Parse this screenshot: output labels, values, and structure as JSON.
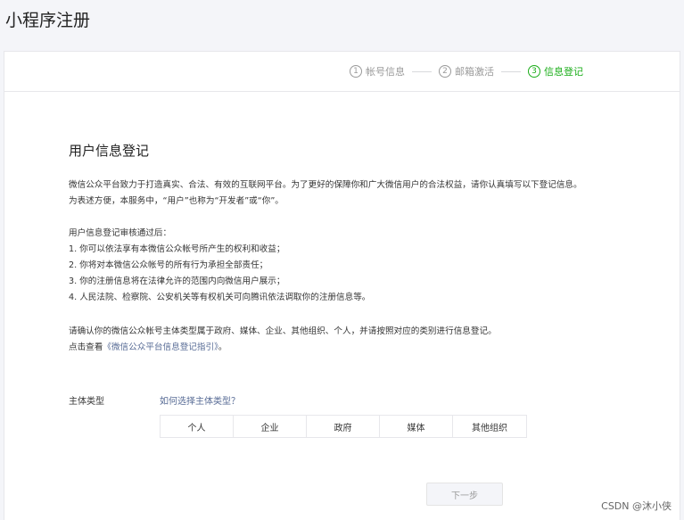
{
  "page_title": "小程序注册",
  "steps": [
    {
      "num": "1",
      "label": "帐号信息"
    },
    {
      "num": "2",
      "label": "邮箱激活"
    },
    {
      "num": "3",
      "label": "信息登记"
    }
  ],
  "active_step_color": "#1aad19",
  "section_title": "用户信息登记",
  "intro": {
    "line1": "微信公众平台致力于打造真实、合法、有效的互联网平台。为了更好的保障你和广大微信用户的合法权益，请你认真填写以下登记信息。",
    "line2": "为表述方便，本服务中，“用户”也称为“开发者”或“你”。"
  },
  "approval": {
    "heading": "用户信息登记审核通过后：",
    "items": [
      "1. 你可以依法享有本微信公众帐号所产生的权利和收益；",
      "2. 你将对本微信公众帐号的所有行为承担全部责任；",
      "3. 你的注册信息将在法律允许的范围内向微信用户展示；",
      "4. 人民法院、检察院、公安机关等有权机关可向腾讯依法调取你的注册信息等。"
    ]
  },
  "confirm": {
    "line1": "请确认你的微信公众帐号主体类型属于政府、媒体、企业、其他组织、个人，并请按照对应的类别进行信息登记。",
    "line2_prefix": "点击查看",
    "line2_link": "《微信公众平台信息登记指引》",
    "line2_suffix": "。"
  },
  "subject_type": {
    "label": "主体类型",
    "help_link": "如何选择主体类型？",
    "options": [
      "个人",
      "企业",
      "政府",
      "媒体",
      "其他组织"
    ]
  },
  "next_button": "下一步",
  "watermark": "CSDN @沐小侠"
}
